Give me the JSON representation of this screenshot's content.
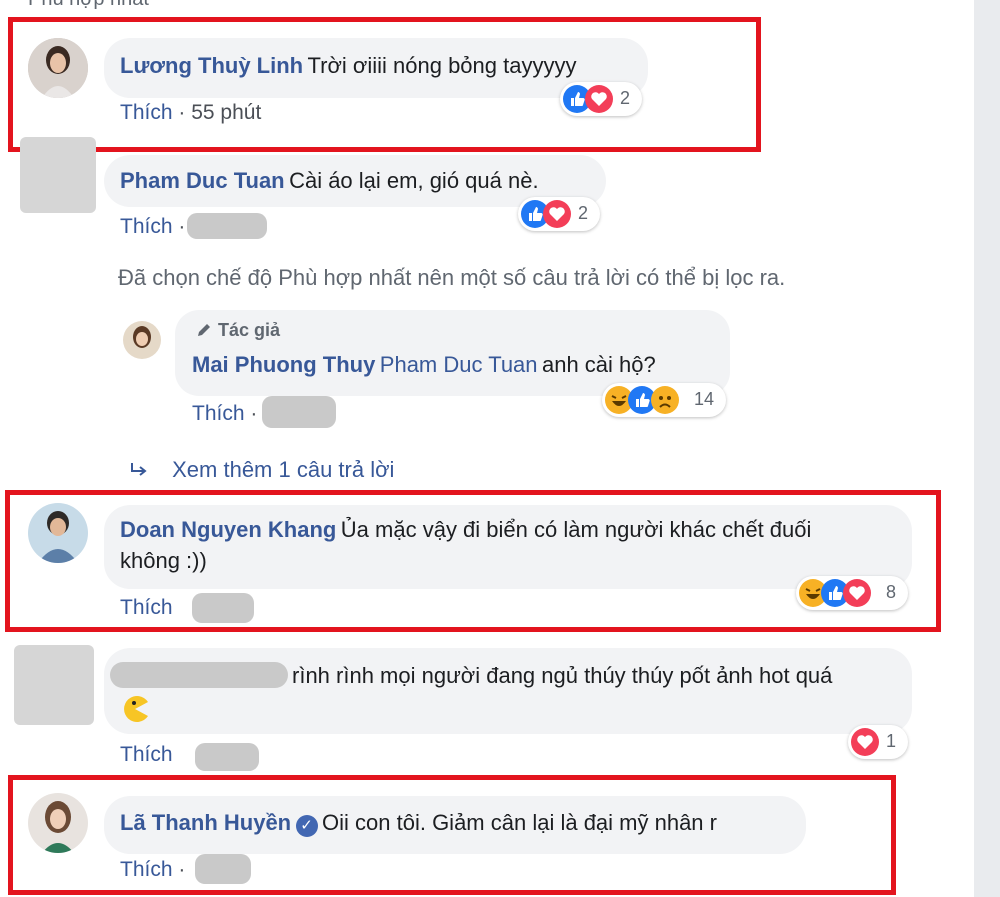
{
  "top_label": "Phù hợp nhất",
  "like_label": "Thích",
  "separator": "·",
  "filter_notice": "Đã chọn chế độ Phù hợp nhất nên một số câu trả lời có thể bị lọc ra.",
  "view_more": "Xem thêm 1 câu trả lời",
  "colors": {
    "highlight_border": "#e3141e",
    "name_link": "#385898",
    "bubble_bg": "#f2f3f5"
  },
  "comments": [
    {
      "author": "Lương Thuỳ Linh",
      "text": "Trời ơiiii nóng bỏng tayyyyy",
      "time": "55 phút",
      "reactions": [
        "like",
        "love"
      ],
      "reaction_count": "2",
      "highlighted": true
    },
    {
      "author": "Pham Duc Tuan",
      "text": "Cài áo lại em, gió quá nè.",
      "reactions": [
        "like",
        "love"
      ],
      "reaction_count": "2",
      "highlighted": false
    },
    {
      "author": "Mai Phuong Thuy",
      "badge": "Tác giả",
      "mention": "Pham Duc Tuan",
      "text": "anh cài hộ?",
      "reactions": [
        "haha",
        "like",
        "sad"
      ],
      "reaction_count": "14",
      "highlighted": false,
      "is_reply": true
    },
    {
      "author": "Doan Nguyen Khang",
      "text_line1": "Ủa mặc vậy đi biển có làm người khác chết đuối",
      "text_line2": "không :))",
      "reactions": [
        "haha",
        "like",
        "love"
      ],
      "reaction_count": "8",
      "highlighted": true
    },
    {
      "author": "",
      "text": "rình rình mọi người đang ngủ thúy thúy pốt ảnh hot quá",
      "emoji": "pacman",
      "reactions": [
        "love"
      ],
      "reaction_count": "1",
      "highlighted": false
    },
    {
      "author": "Lã Thanh Huyền",
      "verified": true,
      "text": "Oii con tôi. Giảm cân lại là đại mỹ nhân r",
      "highlighted": true
    }
  ]
}
